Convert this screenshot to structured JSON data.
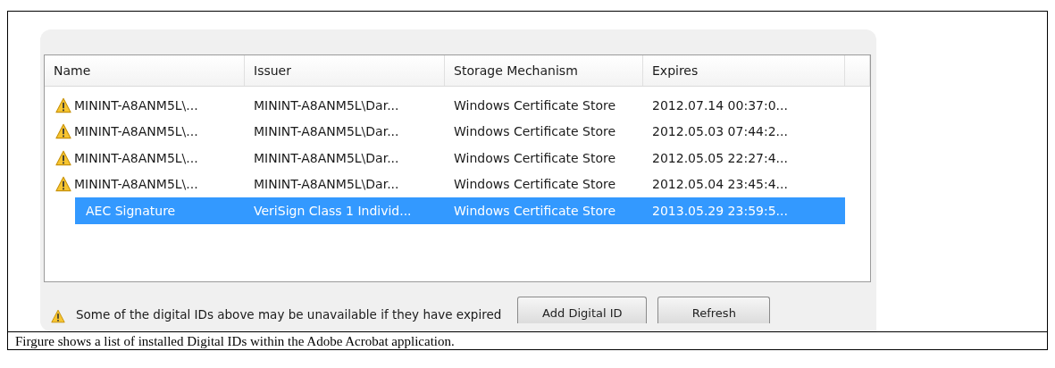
{
  "table": {
    "columns": [
      "Name",
      "Issuer",
      "Storage Mechanism",
      "Expires"
    ],
    "rows": [
      {
        "warning": true,
        "selected": false,
        "cells": [
          "MININT-A8ANM5L\\...",
          "MININT-A8ANM5L\\Dar...",
          "Windows Certificate Store",
          "2012.07.14 00:37:0..."
        ]
      },
      {
        "warning": true,
        "selected": false,
        "cells": [
          "MININT-A8ANM5L\\...",
          "MININT-A8ANM5L\\Dar...",
          "Windows Certificate Store",
          "2012.05.03 07:44:2..."
        ]
      },
      {
        "warning": true,
        "selected": false,
        "cells": [
          "MININT-A8ANM5L\\...",
          "MININT-A8ANM5L\\Dar...",
          "Windows Certificate Store",
          "2012.05.05 22:27:4..."
        ]
      },
      {
        "warning": true,
        "selected": false,
        "cells": [
          "MININT-A8ANM5L\\...",
          "MININT-A8ANM5L\\Dar...",
          "Windows Certificate Store",
          "2012.05.04 23:45:4..."
        ]
      },
      {
        "warning": false,
        "selected": true,
        "cells": [
          "AEC Signature",
          "VeriSign Class 1 Individ...",
          "Windows Certificate Store",
          "2013.05.29 23:59:5..."
        ]
      }
    ]
  },
  "notice": "Some of the digital IDs above may be unavailable if they have expired",
  "buttons": [
    "Add Digital ID",
    "Refresh"
  ],
  "caption": "Firgure shows a list of installed Digital IDs within the Adobe Acrobat application."
}
